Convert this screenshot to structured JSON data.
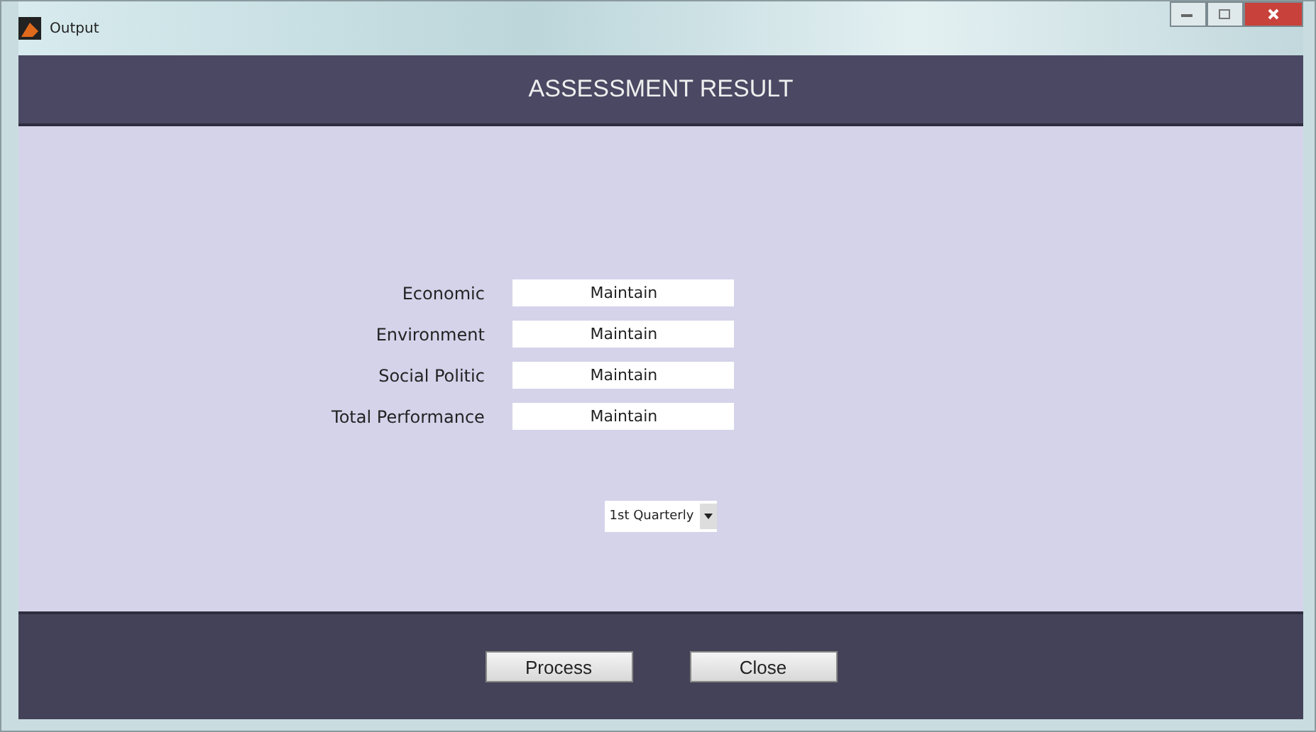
{
  "window": {
    "title": "Output"
  },
  "header": "ASSESSMENT RESULT",
  "results": [
    {
      "label": "Economic",
      "value": "Maintain"
    },
    {
      "label": "Environment",
      "value": "Maintain"
    },
    {
      "label": "Social Politic",
      "value": "Maintain"
    },
    {
      "label": "Total Performance",
      "value": "Maintain"
    }
  ],
  "period": {
    "value": "1st Quarterly"
  },
  "buttons": [
    "Process",
    "Close"
  ]
}
